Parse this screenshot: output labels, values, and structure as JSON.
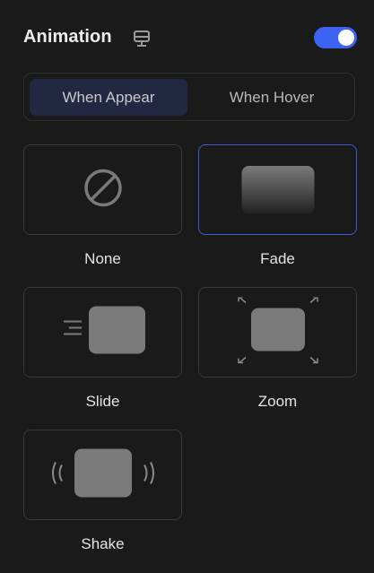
{
  "section": {
    "title": "Animation",
    "device_icon": "desktop-monitor-icon",
    "toggle_on": true
  },
  "colors": {
    "accent": "#3d63f2",
    "active_tab_bg": "#222841",
    "selected_border": "#3d5bd6",
    "preview_fill": "#7a7a7a"
  },
  "tabs": [
    {
      "label": "When Appear",
      "active": true
    },
    {
      "label": "When Hover",
      "active": false
    }
  ],
  "options": [
    {
      "label": "None",
      "icon": "no-symbol-icon",
      "selected": false
    },
    {
      "label": "Fade",
      "icon": "fade-gradient-icon",
      "selected": true
    },
    {
      "label": "Slide",
      "icon": "slide-icon",
      "selected": false
    },
    {
      "label": "Zoom",
      "icon": "zoom-icon",
      "selected": false
    },
    {
      "label": "Shake",
      "icon": "shake-icon",
      "selected": false
    }
  ]
}
